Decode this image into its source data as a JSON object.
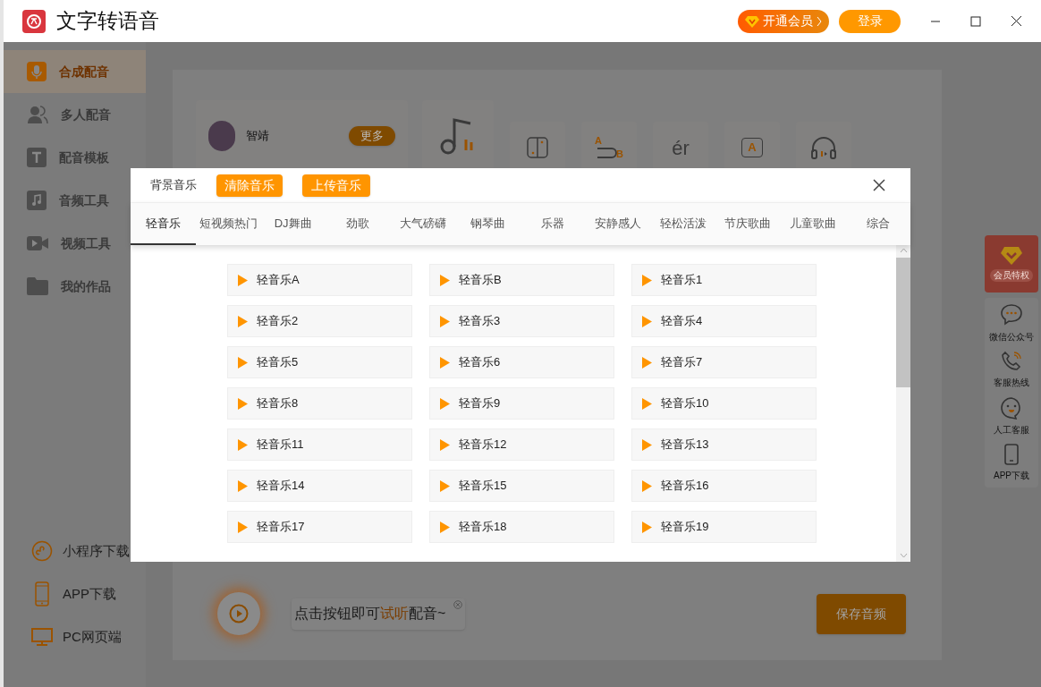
{
  "window": {
    "title": "文字转语音",
    "vip_button": "开通会员",
    "login_button": "登录"
  },
  "sidebar": {
    "items": [
      {
        "label": "合成配音",
        "kind": "mic",
        "selected": true
      },
      {
        "label": "多人配音",
        "kind": "people",
        "selected": false
      },
      {
        "label": "配音模板",
        "kind": "template",
        "selected": false
      },
      {
        "label": "音频工具",
        "kind": "audio",
        "selected": false
      },
      {
        "label": "视频工具",
        "kind": "video",
        "selected": false
      },
      {
        "label": "我的作品",
        "kind": "folder",
        "selected": false
      }
    ],
    "links": [
      {
        "label": "小程序下载",
        "kind": "miniapp"
      },
      {
        "label": "APP下载",
        "kind": "phone"
      },
      {
        "label": "PC网页端",
        "kind": "monitor"
      }
    ]
  },
  "toolbar": {
    "voice": {
      "name": "智靖",
      "more": "更多"
    },
    "tools": [
      {
        "kind": "music"
      },
      {
        "kind": "pause"
      },
      {
        "kind": "import",
        "glyph": "AB"
      },
      {
        "kind": "erhua",
        "glyph": "ér"
      },
      {
        "kind": "polyphone",
        "glyph": "A"
      },
      {
        "kind": "preview"
      }
    ]
  },
  "player": {
    "hint": [
      {
        "text": "点击按钮即可",
        "highlight": false
      },
      {
        "text": "试听",
        "highlight": true
      },
      {
        "text": "配音~",
        "highlight": false
      }
    ],
    "save_button": "保存音频"
  },
  "side_panel": {
    "vip_badge": "会员特权",
    "items": [
      {
        "label": "微信公众号",
        "kind": "chat"
      },
      {
        "label": "客服热线",
        "kind": "phonecall"
      },
      {
        "label": "人工客服",
        "kind": "smile"
      },
      {
        "label": "APP下载",
        "kind": "phone"
      }
    ]
  },
  "dialog": {
    "title": "背景音乐",
    "clear_button": "清除音乐",
    "upload_button": "上传音乐",
    "tabs": [
      {
        "label": "轻音乐",
        "selected": true
      },
      {
        "label": "短视频热门",
        "selected": false
      },
      {
        "label": "DJ舞曲",
        "selected": false
      },
      {
        "label": "劲歌",
        "selected": false
      },
      {
        "label": "大气磅礴",
        "selected": false
      },
      {
        "label": "钢琴曲",
        "selected": false
      },
      {
        "label": "乐器",
        "selected": false
      },
      {
        "label": "安静感人",
        "selected": false
      },
      {
        "label": "轻松活泼",
        "selected": false
      },
      {
        "label": "节庆歌曲",
        "selected": false
      },
      {
        "label": "儿童歌曲",
        "selected": false
      },
      {
        "label": "综合",
        "selected": false
      }
    ],
    "tracks": [
      "轻音乐A",
      "轻音乐B",
      "轻音乐1",
      "轻音乐2",
      "轻音乐3",
      "轻音乐4",
      "轻音乐5",
      "轻音乐6",
      "轻音乐7",
      "轻音乐8",
      "轻音乐9",
      "轻音乐10",
      "轻音乐11",
      "轻音乐12",
      "轻音乐13",
      "轻音乐14",
      "轻音乐15",
      "轻音乐16",
      "轻音乐17",
      "轻音乐18",
      "轻音乐19"
    ]
  }
}
